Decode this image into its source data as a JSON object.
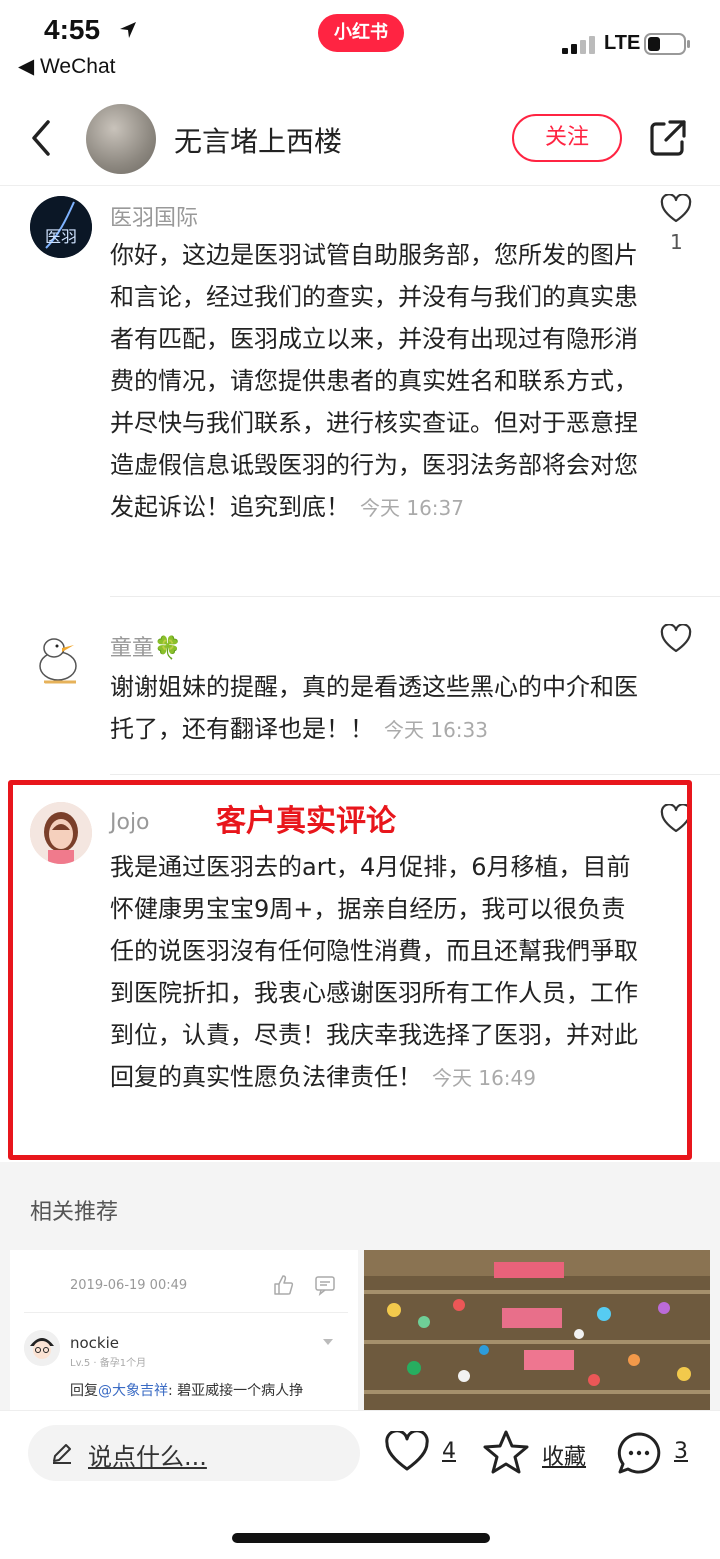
{
  "status_bar": {
    "time": "4:55",
    "back_app": "◀ WeChat",
    "brand": "小红书",
    "network": "LTE"
  },
  "header": {
    "title": "无言堵上西楼",
    "follow_label": "关注"
  },
  "comments": [
    {
      "author": "医羽国际",
      "text": "你好，这边是医羽试管自助服务部，您所发的图片和言论，经过我们的查实，并没有与我们的真实患者有匹配，医羽成立以来，并没有出现过有隐形消费的情况，请您提供患者的真实姓名和联系方式，并尽快与我们联系，进行核实查证。但对于恶意捏造虚假信息诋毁医羽的行为，医羽法务部将会对您发起诉讼！追究到底！",
      "time": "今天 16:37",
      "likes": "1",
      "avatar_text": "医羽"
    },
    {
      "author": "童童🍀",
      "text": "谢谢姐妹的提醒，真的是看透这些黑心的中介和医托了，还有翻译也是！！",
      "time": "今天 16:33",
      "likes": ""
    },
    {
      "author": "Jojo",
      "text": "我是通过医羽去的art，4月促排，6月移植，目前怀健康男宝宝9周+，据亲自经历，我可以很负责任的说医羽沒有任何隐性消費，而且还幫我們爭取到医院折扣，我衷心感谢医羽所有工作人员，工作到位，认責，尽责！我庆幸我选择了医羽，并对此回复的真实性愿负法律责任！",
      "time": "今天 16:49",
      "likes": ""
    }
  ],
  "annotation": "客户真实评论",
  "related": {
    "title": "相关推荐",
    "card_left": {
      "date": "2019-06-19 00:49",
      "user": "nockie",
      "level": "Lv.5 · 备孕1个月",
      "reply_prefix": "回复",
      "reply_mention": "@大象吉祥",
      "reply_text": ": 碧亚威接一个病人挣"
    }
  },
  "bottom_bar": {
    "input_placeholder": "说点什么...",
    "likes": "4",
    "favorite_label": "收藏",
    "comments": "3"
  },
  "colors": {
    "brand_red": "#ff2442",
    "annotation_red": "#e8161c"
  }
}
